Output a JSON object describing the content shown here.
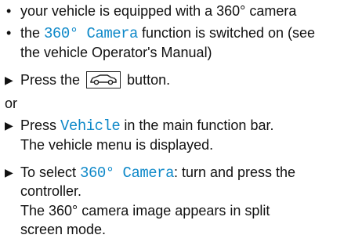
{
  "conditions": [
    {
      "text": "your vehicle is equipped with a 360° camera"
    },
    {
      "pre": "the ",
      "highlight": "360° Camera",
      "post": " function is switched on (see",
      "cont": "the vehicle Operator's Manual)"
    }
  ],
  "step1": {
    "pre": "Press the ",
    "icon": "car-icon",
    "post": " button."
  },
  "or_label": "or",
  "step2": {
    "pre": "Press ",
    "highlight": "Vehicle",
    "post": " in the main function bar.",
    "result": "The vehicle menu is displayed."
  },
  "step3": {
    "pre": "To select ",
    "highlight": "360° Camera",
    "post": ": turn and press the",
    "cont": "controller.",
    "result_line1": "The 360° camera image appears in split",
    "result_line2": "screen mode."
  },
  "colors": {
    "highlight": "#0f89c9",
    "text": "#111111"
  }
}
